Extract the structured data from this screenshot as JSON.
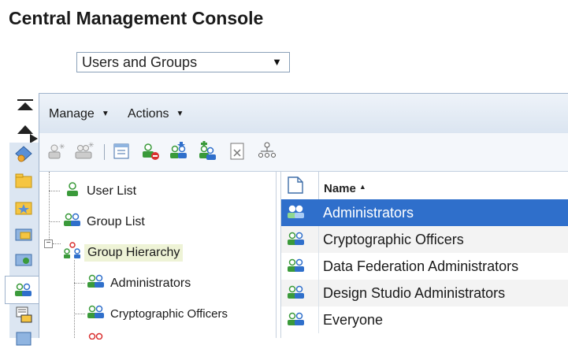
{
  "app": {
    "title": "Central Management Console"
  },
  "nav_select": {
    "value": "Users and Groups"
  },
  "menubar": {
    "items": [
      {
        "label": "Manage"
      },
      {
        "label": "Actions"
      }
    ]
  },
  "tree": {
    "items": [
      {
        "label": "User List"
      },
      {
        "label": "Group List"
      },
      {
        "label": "Group Hierarchy"
      },
      {
        "label": "Administrators"
      },
      {
        "label": "Cryptographic Officers"
      }
    ]
  },
  "list": {
    "column_name": "Name",
    "rows": [
      {
        "name": "Administrators",
        "selected": true
      },
      {
        "name": "Cryptographic Officers"
      },
      {
        "name": "Data Federation Administrators"
      },
      {
        "name": "Design Studio Administrators"
      },
      {
        "name": "Everyone"
      }
    ]
  },
  "colors": {
    "selection": "#2f6fcb",
    "toolbar": "#dbe5f1",
    "rail": "#dce6f2",
    "user_icon_green": "#3a9a3a",
    "user_icon_blue": "#2f6fcb"
  }
}
